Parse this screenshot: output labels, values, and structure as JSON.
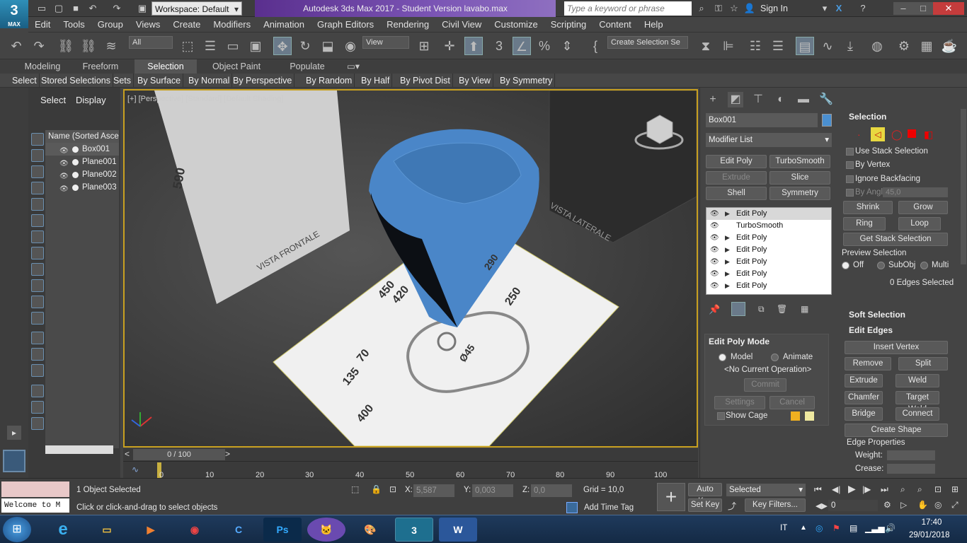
{
  "titlebar": {
    "app_logo": "3",
    "app_logo_sub": "MAX",
    "workspace": "Workspace: Default",
    "title": "Autodesk 3ds Max 2017 - Student Version    lavabo.max",
    "search_placeholder": "Type a keyword or phrase",
    "sign_in": "Sign In"
  },
  "menu": [
    "Edit",
    "Tools",
    "Group",
    "Views",
    "Create",
    "Modifiers",
    "Animation",
    "Graph Editors",
    "Rendering",
    "Civil View",
    "Customize",
    "Scripting",
    "Content",
    "Help"
  ],
  "toolbar": {
    "filter": "All",
    "ref_coord": "View",
    "selection_set": "Create Selection Se"
  },
  "ribbon": {
    "tabs": [
      "Modeling",
      "Freeform",
      "Selection",
      "Object Paint",
      "Populate"
    ],
    "selected_tab": "Selection",
    "items": [
      "Select",
      "Stored Selections",
      "Sets",
      "By Surface",
      "By Normal",
      "By Perspective",
      "By Random",
      "By Half",
      "By Pivot Dist",
      "By View",
      "By Symmetry"
    ]
  },
  "scene_explorer": {
    "tabs": [
      "Select",
      "Display"
    ],
    "header": "Name (Sorted Ascer",
    "objects": [
      "Box001",
      "Plane001",
      "Plane002",
      "Plane003"
    ]
  },
  "viewport": {
    "label": "[+] [Perspective] [Standard] [Default Shading]",
    "dims": [
      "590",
      "VISTA FRONTALE",
      "VISTA LATERALE",
      "450",
      "420",
      "70",
      "135",
      "400",
      "250",
      "Ø45",
      "290"
    ]
  },
  "timeline": {
    "slider": "0 / 100",
    "ticks": [
      "0",
      "10",
      "20",
      "30",
      "40",
      "50",
      "60",
      "70",
      "80",
      "90",
      "100"
    ]
  },
  "command_panel": {
    "object_name": "Box001",
    "object_color": "#4a8fd0",
    "modifier_list": "Modifier List",
    "mod_buttons": [
      "Edit Poly",
      "TurboSmooth",
      "Extrude",
      "Slice",
      "Shell",
      "Symmetry"
    ],
    "stack": [
      "Edit Poly",
      "TurboSmooth",
      "Edit Poly",
      "Edit Poly",
      "Edit Poly",
      "Edit Poly",
      "Edit Poly"
    ],
    "edit_poly_mode": {
      "title": "Edit Poly Mode",
      "model": "Model",
      "animate": "Animate",
      "current_op": "<No Current Operation>",
      "commit": "Commit",
      "settings": "Settings",
      "cancel": "Cancel",
      "show_cage": "Show Cage"
    },
    "selection": {
      "title": "Selection",
      "use_stack": "Use Stack Selection",
      "by_vertex": "By Vertex",
      "ignore_backfacing": "Ignore Backfacing",
      "by_angle": "By Angle:",
      "angle_value": "45,0",
      "shrink": "Shrink",
      "grow": "Grow",
      "ring": "Ring",
      "loop": "Loop",
      "get_stack": "Get Stack Selection",
      "preview": "Preview Selection",
      "off": "Off",
      "subobj": "SubObj",
      "multi": "Multi",
      "status": "0 Edges Selected"
    },
    "soft_selection": "Soft Selection",
    "edit_edges": {
      "title": "Edit Edges",
      "insert_vertex": "Insert Vertex",
      "remove": "Remove",
      "split": "Split",
      "extrude": "Extrude",
      "weld": "Weld",
      "chamfer": "Chamfer",
      "target_weld": "Target Weld",
      "bridge": "Bridge",
      "connect": "Connect",
      "create_shape": "Create Shape",
      "edge_props": "Edge Properties",
      "weight": "Weight:",
      "crease": "Crease:"
    }
  },
  "status": {
    "maxscript": "Welcome to M",
    "selected": "1 Object Selected",
    "prompt": "Click or click-and-drag to select objects",
    "x_label": "X:",
    "x": "5,587",
    "y_label": "Y:",
    "y": "0,003",
    "z_label": "Z:",
    "z": "0,0",
    "grid": "Grid = 10,0",
    "add_time_tag": "Add Time Tag",
    "auto_key": "Auto Key",
    "set_key": "Set Key",
    "key_mode": "Selected",
    "key_filters": "Key Filters...",
    "frame": "0"
  },
  "taskbar": {
    "lang": "IT",
    "time": "17:40",
    "date": "29/01/2018"
  }
}
